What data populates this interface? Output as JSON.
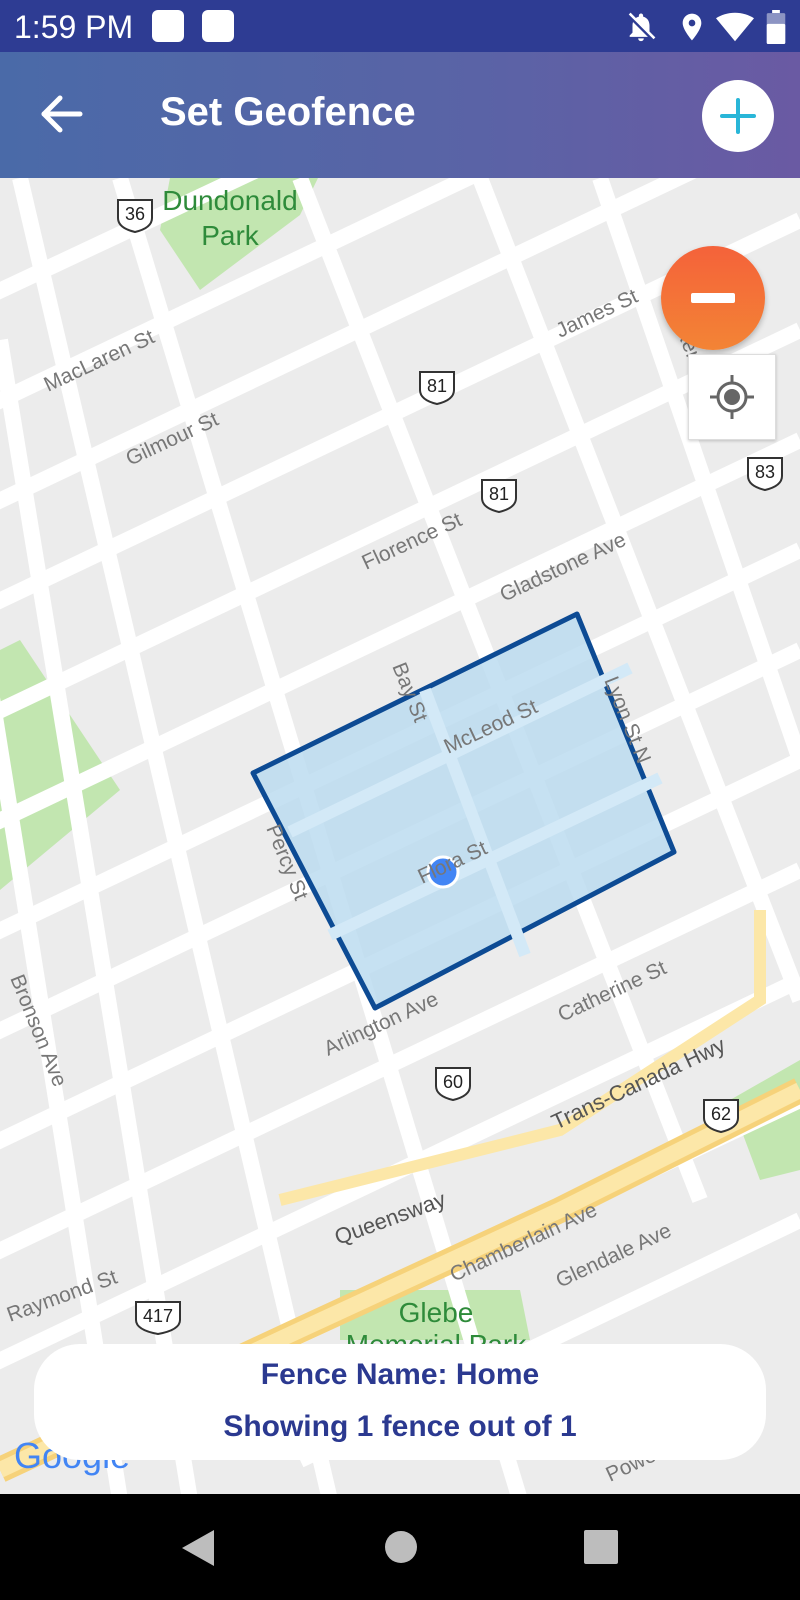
{
  "status_bar": {
    "time": "1:59 PM",
    "icons": [
      "notification-square-icon",
      "notification-square-icon",
      "notifications-off-icon",
      "location-pin-icon",
      "wifi-icon",
      "battery-icon"
    ]
  },
  "app_bar": {
    "title": "Set Geofence",
    "back_icon": "arrow-back-icon",
    "add_icon": "plus-icon"
  },
  "map": {
    "labels": {
      "park1": "Dundonald",
      "park1b": "Park",
      "maclaren": "MacLaren St",
      "gilmour": "Gilmour St",
      "james": "James St",
      "florence": "Florence St",
      "gladstone": "Gladstone Ave",
      "bay": "Bay St",
      "mcleod": "McLeod St",
      "lyon": "Lyon St N",
      "percy": "Percy St",
      "flora": "Flora St",
      "catherine": "Catherine St",
      "arlington": "Arlington Ave",
      "bronson": "Bronson Ave",
      "transcanada": "Trans-Canada Hwy",
      "queensway": "Queensway",
      "chamberlain": "Chamberlain Ave",
      "glendale": "Glendale Ave",
      "raymond": "Raymond St",
      "glebe": "Glebe",
      "glebe2": "Memorial Park",
      "powell": "Powel",
      "google": "Google",
      "kent": "Kent St"
    },
    "shields": {
      "s36": "36",
      "s81a": "81",
      "s81b": "81",
      "s83": "83",
      "s60": "60",
      "s62": "62",
      "s417": "417"
    },
    "fence_color": "#0d4b94",
    "fence_fill": "#bcdcf0",
    "marker_color": "#4285f4"
  },
  "controls": {
    "remove_icon": "minus-icon",
    "my_location_icon": "my-location-icon"
  },
  "info_card": {
    "fence_name": "Fence Name: Home",
    "count": "Showing 1 fence out of 1"
  },
  "nav_bar": {
    "back": "triangle-back-icon",
    "home": "circle-home-icon",
    "recents": "square-recents-icon"
  }
}
